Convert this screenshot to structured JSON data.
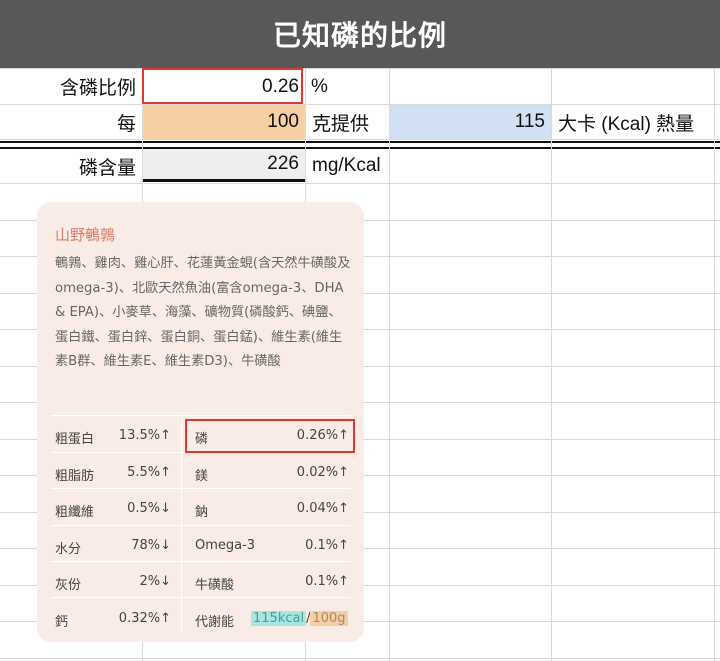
{
  "title": "已知磷的比例",
  "rows": {
    "ratio": {
      "label": "含磷比例",
      "value": "0.26",
      "unit": "%"
    },
    "per": {
      "label": "每",
      "grams": "100",
      "mid_label": "克提供",
      "kcal": "115",
      "unit": "大卡 (Kcal) 熱量"
    },
    "content": {
      "label": "磷含量",
      "value": "226",
      "unit": "mg/Kcal"
    }
  },
  "label_card": {
    "title": "山野鵪鶉",
    "ingredients": "鵪鶉、雞肉、雞心肝、花蓮黃金蜆(含天然牛磺酸及omega-3)、北歐天然魚油(富含omega-3、DHA & EPA)、小麥草、海藻、礦物質(磷酸鈣、碘鹽、蛋白鐵、蛋白鋅、蛋白銅、蛋白錳)、維生素(維生素B群、維生素E、維生素D3)、牛磺酸",
    "nutrients_left": [
      {
        "name": "粗蛋白",
        "value": "13.5%↑"
      },
      {
        "name": "粗脂肪",
        "value": "5.5%↑"
      },
      {
        "name": "粗纖維",
        "value": "0.5%↓"
      },
      {
        "name": "水分",
        "value": "78%↓"
      },
      {
        "name": "灰份",
        "value": "2%↓"
      },
      {
        "name": "鈣",
        "value": "0.32%↑"
      }
    ],
    "nutrients_right": [
      {
        "name": "磷",
        "value": "0.26%↑"
      },
      {
        "name": "鎂",
        "value": "0.02%↑"
      },
      {
        "name": "鈉",
        "value": "0.04%↑"
      },
      {
        "name": "Omega-3",
        "value": "0.1%↑"
      },
      {
        "name": "牛磺酸",
        "value": "0.1%↑"
      },
      {
        "name": "代謝能",
        "value_a": "115kcal",
        "value_sep": "/",
        "value_b": "100g"
      }
    ]
  },
  "colors": {
    "title_bg": "#585858",
    "highlight_orange": "#f6cfa5",
    "highlight_blue": "#d2e0f3",
    "highlight_gray": "#eeeeee",
    "red_border": "#e0382f",
    "card_bg": "#f9ece6"
  }
}
